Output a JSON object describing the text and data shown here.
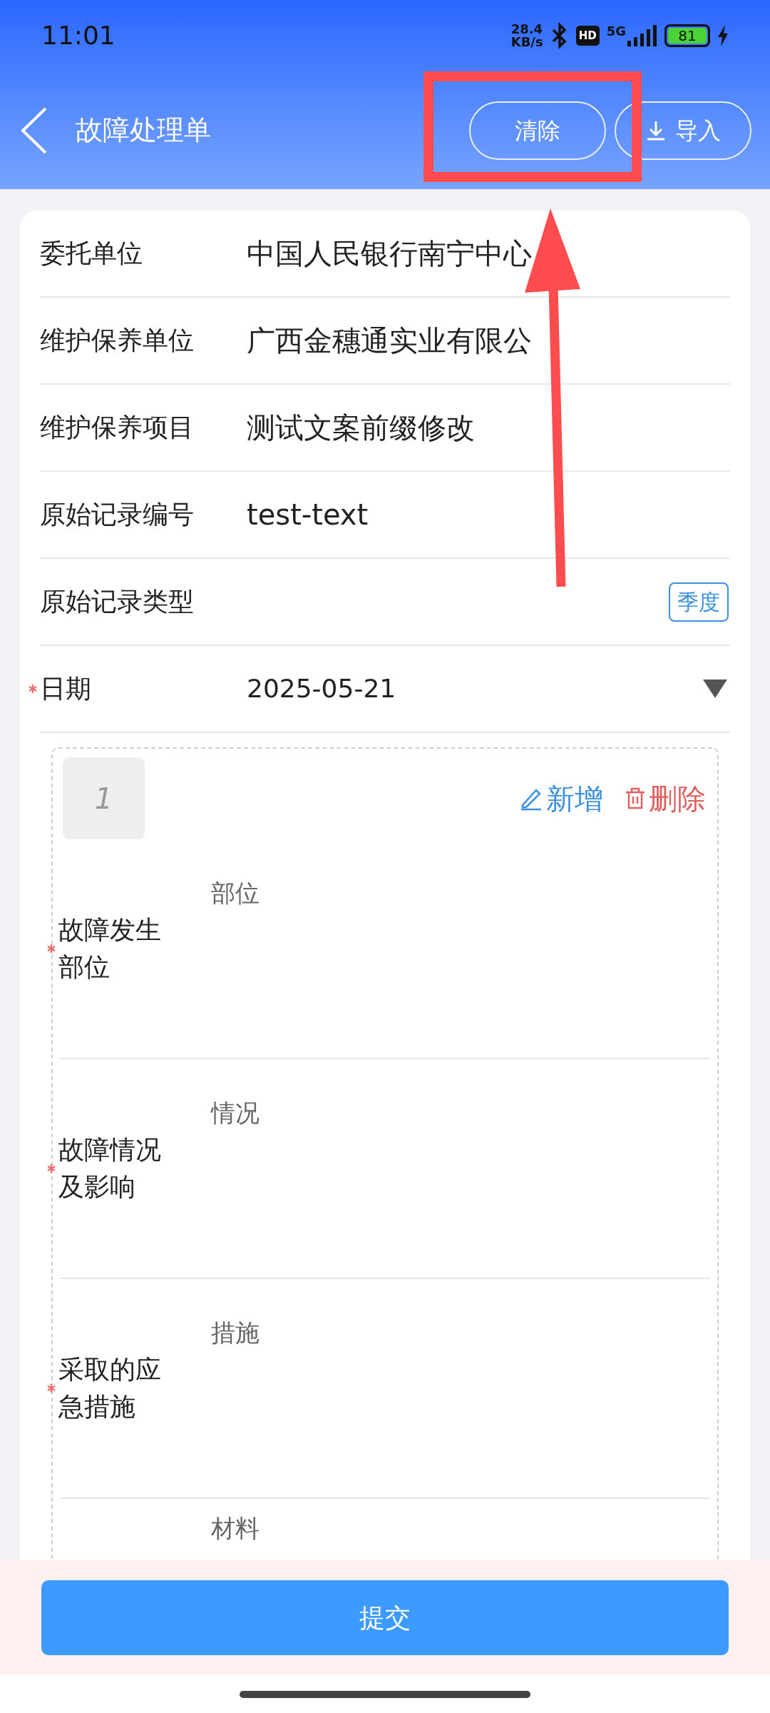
{
  "status_bar": {
    "time": "11:01",
    "net_speed": [
      "28.4",
      "KB/s"
    ],
    "hd": "HD",
    "network": "5G",
    "battery": "81",
    "charging": true
  },
  "header": {
    "title": "故障处理单",
    "buttons": [
      {
        "label": "清除",
        "kind": "plain"
      },
      {
        "label": "导入",
        "kind": "download"
      }
    ]
  },
  "fields": [
    {
      "label": "委托单位",
      "value": "中国人民银行南宁中心",
      "required": false,
      "kind": "text"
    },
    {
      "label": "维护保养单位",
      "value": "广西金穗通实业有限公",
      "required": false,
      "kind": "text"
    },
    {
      "label": "维护保养项目",
      "value": "测试文案前缀修改",
      "required": false,
      "kind": "text"
    },
    {
      "label": "原始记录编号",
      "value": "test-text",
      "required": false,
      "kind": "text"
    },
    {
      "label": "原始记录类型",
      "value": "季度",
      "required": false,
      "kind": "tag"
    },
    {
      "label": "日期",
      "value": "2025-05-21",
      "required": true,
      "kind": "dropdown"
    }
  ],
  "fault_item": {
    "index": "1",
    "actions": [
      {
        "label": "新增",
        "kind": "edit"
      },
      {
        "label": "删除",
        "kind": "delete"
      }
    ],
    "fields": [
      {
        "label": "故障发生部位",
        "required": true,
        "placeholder": "部位"
      },
      {
        "label": "故障情况及影响",
        "required": true,
        "placeholder": "情况"
      },
      {
        "label": "采取的应急措施",
        "required": true,
        "placeholder": "措施"
      },
      {
        "placeholder": "材料"
      }
    ]
  },
  "submit": "提交"
}
